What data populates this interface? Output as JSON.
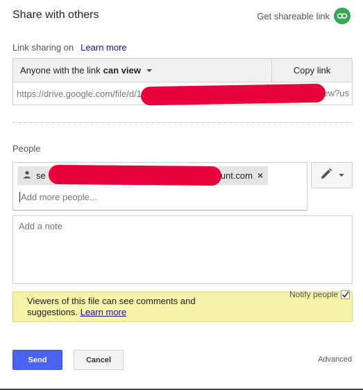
{
  "dialog": {
    "title": "Share with others",
    "shareable_link_label": "Get shareable link"
  },
  "link_sharing": {
    "label": "Link sharing on",
    "learn_more": "Learn more",
    "access_prefix": "Anyone with the link",
    "access_level": "can view",
    "copy_button": "Copy link",
    "url_start": "https://drive.google.com/file/d/1",
    "url_end": "ew?us"
  },
  "people": {
    "label": "People",
    "chip_prefix": "se",
    "chip_suffix": "unt.com",
    "add_placeholder": "Add more people..."
  },
  "note": {
    "placeholder": "Add a note"
  },
  "notify": {
    "label": "Notify people",
    "checked": true
  },
  "info": {
    "text": "Viewers of this file can see comments and suggestions.",
    "learn_more": "Learn more"
  },
  "actions": {
    "send": "Send",
    "cancel": "Cancel",
    "advanced": "Advanced"
  },
  "colors": {
    "accent_blue": "#4a63f0",
    "link_green": "#34a853",
    "info_yellow": "#f5f3a8",
    "redaction_red": "#e8003a"
  }
}
